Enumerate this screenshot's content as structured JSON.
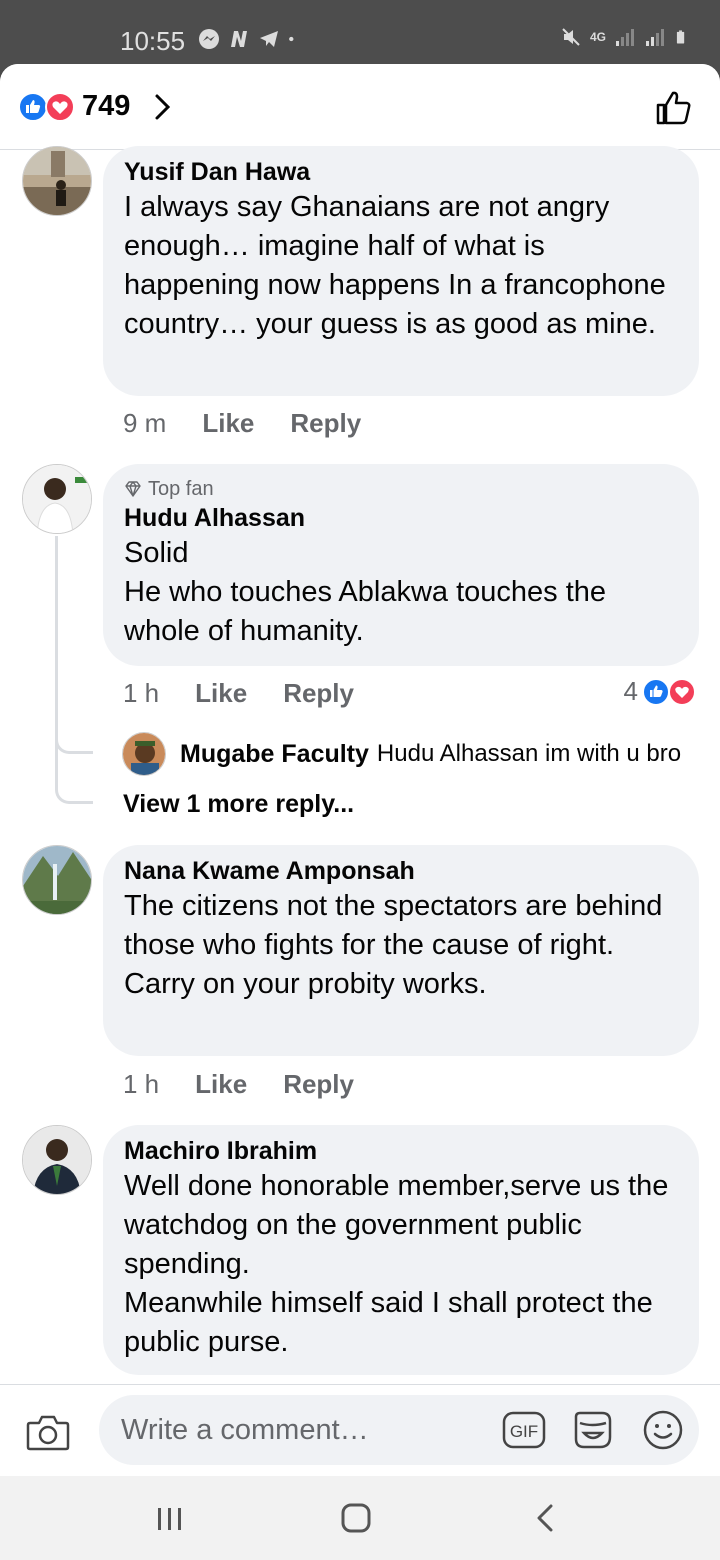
{
  "status_bar": {
    "time": "10:55",
    "left_icons": [
      "messenger-icon",
      "n-app-icon",
      "telegram-icon",
      "dot-icon"
    ],
    "right_icons": [
      "mute-icon",
      "network-4g-icon",
      "signal-icon",
      "signal-icon",
      "battery-icon"
    ],
    "network_label": "4G"
  },
  "header": {
    "reaction_count": "749",
    "reaction_icons": [
      "like-reaction-icon",
      "love-reaction-icon"
    ]
  },
  "comments": [
    {
      "author": "Yusif Dan Hawa",
      "text": "I always say Ghanaians are not angry enough… imagine half of what is happening now happens In a francophone country… your guess is as good as mine.",
      "time": "9 m",
      "like": "Like",
      "reply": "Reply"
    },
    {
      "badge": "Top fan",
      "author": "Hudu Alhassan",
      "text_lines": [
        "Solid",
        "He who touches Ablakwa touches the whole of humanity."
      ],
      "time": "1 h",
      "like": "Like",
      "reply": "Reply",
      "reaction_count": "4",
      "replies": [
        {
          "author": "Mugabe Faculty",
          "text": "Hudu Alhassan im with u bro"
        }
      ],
      "view_more": "View 1 more reply..."
    },
    {
      "author": "Nana Kwame Amponsah",
      "text_lines": [
        "The citizens not the spectators are behind those who fights for the cause of right.",
        "Carry on your probity works."
      ],
      "time": "1 h",
      "like": "Like",
      "reply": "Reply"
    },
    {
      "author": "Machiro Ibrahim",
      "text_lines": [
        "Well done honorable member,serve us the watchdog on the government public spending.",
        "Meanwhile himself said I shall protect the public purse."
      ]
    }
  ],
  "composer": {
    "placeholder": "Write a comment…",
    "gif_label": "GIF"
  },
  "colors": {
    "like_blue": "#1877f2",
    "love_red": "#f33e58",
    "bubble_gray": "#f0f2f5",
    "secondary_text": "#65676b"
  }
}
